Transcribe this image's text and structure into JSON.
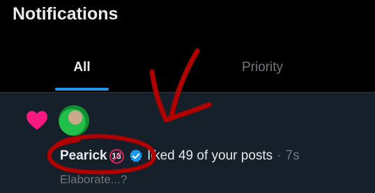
{
  "header": {
    "title": "Notifications"
  },
  "tabs": [
    {
      "label": "All",
      "active": true
    },
    {
      "label": "Priority",
      "active": false
    }
  ],
  "notification": {
    "username": "Pearick",
    "age_badge": "18",
    "action": "liked 49 of your posts",
    "separator": "·",
    "time": "7s",
    "preview": "Elaborate...?"
  },
  "colors": {
    "background": "#000000",
    "card": "#15202b",
    "accent": "#1d9bf0",
    "heart": "#f91880",
    "annotation": "#b00000"
  }
}
